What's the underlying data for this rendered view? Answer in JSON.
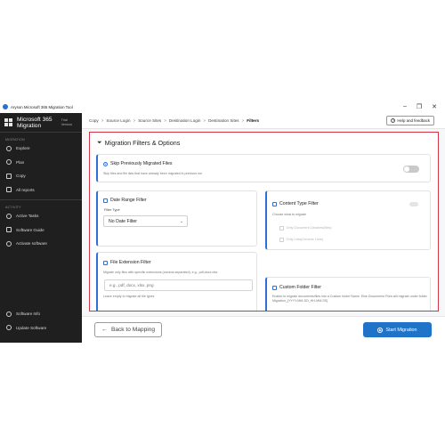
{
  "window": {
    "title": "Aryson Microsoft 365 Migration Tool",
    "controls": [
      "–",
      "❐",
      "✕"
    ]
  },
  "sidebar": {
    "brand_line1": "Microsoft 365",
    "brand_line2": "Migration",
    "trial_line1": "Trial",
    "trial_line2": "Version",
    "section_migration": "MIGRATION",
    "migration_items": [
      {
        "label": "Explore",
        "icon": "compass-icon"
      },
      {
        "label": "Plan",
        "icon": "plan-icon"
      },
      {
        "label": "Copy",
        "icon": "copy-icon"
      },
      {
        "label": "All reports",
        "icon": "reports-icon"
      }
    ],
    "section_activity": "ACTIVITY",
    "activity_items": [
      {
        "label": "Active Tasks",
        "icon": "tasks-icon"
      },
      {
        "label": "Software Guide",
        "icon": "guide-icon"
      },
      {
        "label": "Activate software",
        "icon": "key-icon"
      }
    ],
    "bottom_items": [
      {
        "label": "Software Info",
        "icon": "info-icon"
      },
      {
        "label": "Update Software",
        "icon": "refresh-icon"
      }
    ]
  },
  "breadcrumb": {
    "items": [
      "Copy",
      "Source Login",
      "Source Sites",
      "Destination Login",
      "Destination Sites",
      "Filters"
    ],
    "separator": ">"
  },
  "help_button": "Help and feedback",
  "panel": {
    "title": "Migration Filters & Options",
    "skip": {
      "title": "Skip Previously Migrated Files",
      "desc": "Skip files and file lists that have already been migrated in previous run"
    },
    "date_filter": {
      "title": "Date Range Filter",
      "type_label": "Filter Type",
      "selected": "No Date Filter"
    },
    "content_filter": {
      "title": "Content Type Filter",
      "desc": "Choose what to migrate",
      "options": [
        "Only Document Libraries(files)",
        "Only Lists(Generic Lists)"
      ]
    },
    "ext_filter": {
      "title": "File Extension Filter",
      "desc": "Migrate only files with specific extensions (comma separated), e.g., pdf,docx,xlsx",
      "placeholder": "e.g., pdf, docx, xlsx, png",
      "hint": "Leave empty to migrate all file types"
    },
    "folder_filter": {
      "title": "Custom Folder Filter",
      "desc": "Enable to migrate documents/files into a Custom folder Name. Else Documents Files will migrate under folder Migration_{YYYY-MM-DD_HH-MM-SS}"
    }
  },
  "footer": {
    "back_label": "Back to Mapping",
    "start_label": "Start Migration"
  },
  "colors": {
    "accent": "#2f6fd6",
    "highlight_border": "#d23644",
    "sidebar_bg": "#1f1f1f",
    "primary_button": "#1f73c9"
  }
}
